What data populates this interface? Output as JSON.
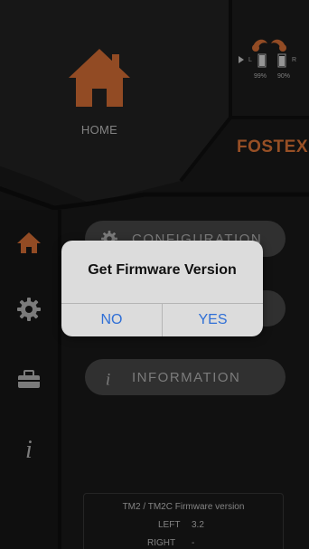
{
  "home": {
    "label": "HOME",
    "icon": "home-icon",
    "color": "#e07438"
  },
  "brand": {
    "text": "FOSTEX",
    "color": "#e87a3a"
  },
  "earbuds": {
    "left": {
      "side": "L",
      "battery": "99%"
    },
    "right": {
      "side": "R",
      "battery": "90%"
    }
  },
  "sidebar": {
    "items": [
      {
        "name": "home",
        "icon": "home-icon",
        "active": true
      },
      {
        "name": "configuration",
        "icon": "gear-icon",
        "active": false
      },
      {
        "name": "toolbox",
        "icon": "toolbox-icon",
        "active": false
      },
      {
        "name": "information",
        "icon": "info-icon",
        "active": false
      }
    ]
  },
  "menu": {
    "configuration": {
      "label": "CONFIGURATION",
      "icon": "gear-icon"
    },
    "information": {
      "label": "INFORMATION",
      "icon": "info-icon"
    }
  },
  "firmware_box": {
    "title": "TM2 / TM2C Firmware version",
    "left_label": "LEFT",
    "left_value": "3.2",
    "right_label": "RIGHT",
    "right_value": "-"
  },
  "dialog": {
    "title": "Get Firmware Version",
    "no_label": "NO",
    "yes_label": "YES",
    "button_color": "#2f6fd6"
  }
}
